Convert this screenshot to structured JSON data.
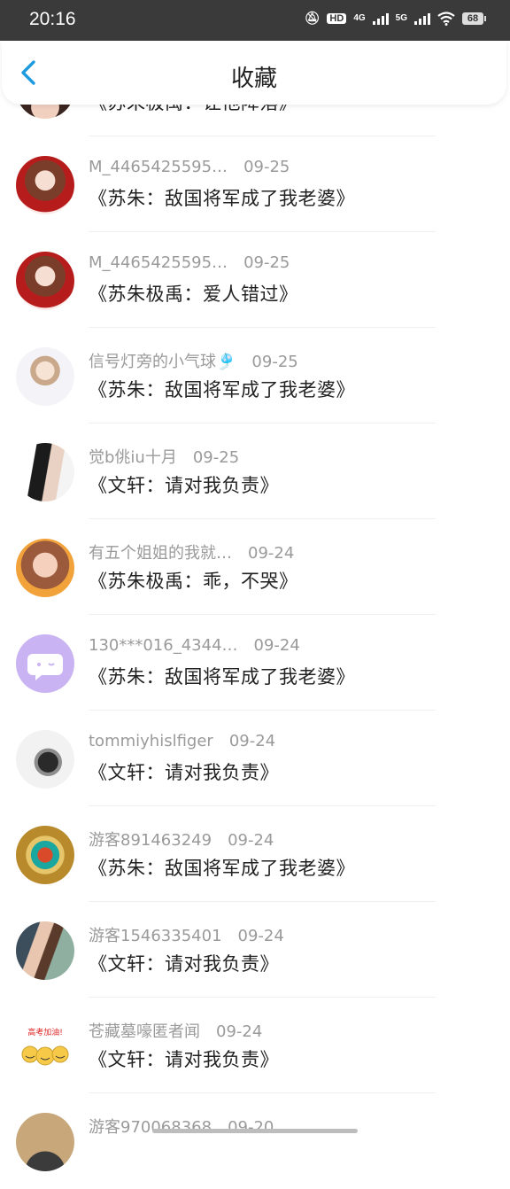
{
  "status": {
    "time": "20:16",
    "battery": "68",
    "net1": "4G",
    "net2": "5G",
    "hd": "HD"
  },
  "header": {
    "title": "收藏"
  },
  "items": [
    {
      "name": "",
      "date": "",
      "title": "《苏朱极禹：让他降落》"
    },
    {
      "name": "M_4465425595…",
      "date": "09-25",
      "title": "《苏朱：敌国将军成了我老婆》"
    },
    {
      "name": "M_4465425595…",
      "date": "09-25",
      "title": "《苏朱极禹：爱人错过》"
    },
    {
      "name": "信号灯旁的小气球🎐",
      "date": "09-25",
      "title": "《苏朱：敌国将军成了我老婆》"
    },
    {
      "name": "觉b佻iu十月",
      "date": "09-25",
      "title": "《文轩：请对我负责》"
    },
    {
      "name": "有五个姐姐的我就…",
      "date": "09-24",
      "title": "《苏朱极禹：乖，不哭》"
    },
    {
      "name": "130***016_4344…",
      "date": "09-24",
      "title": "《苏朱：敌国将军成了我老婆》"
    },
    {
      "name": "tommiyhislfiger",
      "date": "09-24",
      "title": "《文轩：请对我负责》"
    },
    {
      "name": "游客891463249",
      "date": "09-24",
      "title": "《苏朱：敌国将军成了我老婆》"
    },
    {
      "name": "游客1546335401",
      "date": "09-24",
      "title": "《文轩：请对我负责》"
    },
    {
      "name": "苍藏墓嚎匿者闻",
      "date": "09-24",
      "title": "《文轩：请对我负责》"
    },
    {
      "name": "游客970068368",
      "date": "09-20",
      "title": ""
    }
  ],
  "colors": {
    "accent": "#1e9be0",
    "meta_text": "#9a9a9a",
    "title_text": "#222222"
  }
}
